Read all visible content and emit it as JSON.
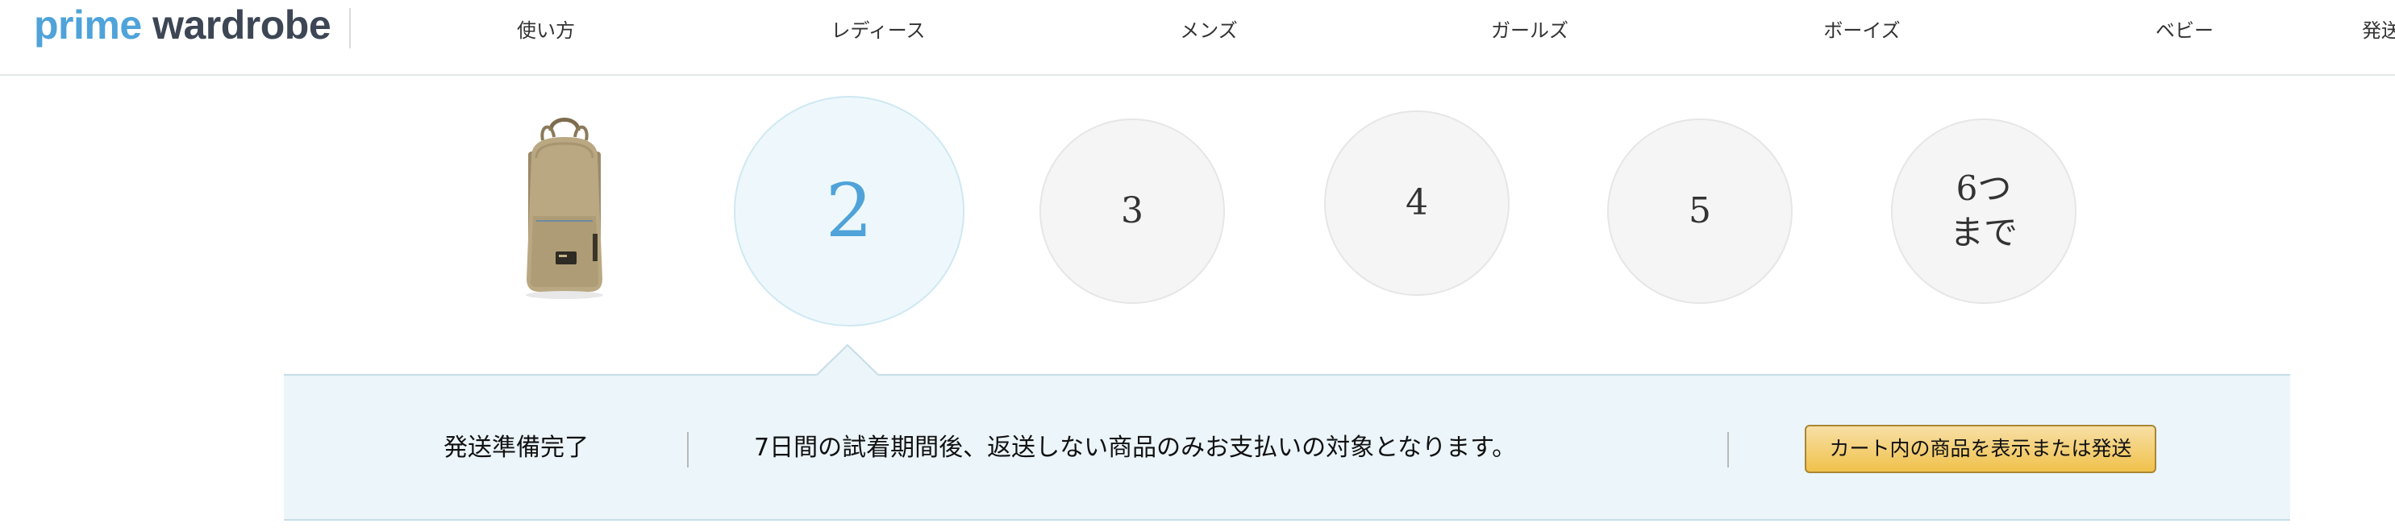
{
  "header": {
    "logo": {
      "prime": "prime",
      "wardrobe": "wardrobe"
    },
    "nav": [
      {
        "label": "使い方"
      },
      {
        "label": "レディース"
      },
      {
        "label": "メンズ"
      },
      {
        "label": "ガールズ"
      },
      {
        "label": "ボーイズ"
      },
      {
        "label": "ベビー"
      },
      {
        "label": "発送"
      }
    ]
  },
  "steps": {
    "product_image": "backpack",
    "items": [
      {
        "label": "2",
        "active": true
      },
      {
        "label": "3",
        "active": false
      },
      {
        "label": "4",
        "active": false
      },
      {
        "label": "5",
        "active": false
      },
      {
        "label": "6つ",
        "label2": "まで",
        "active": false
      }
    ]
  },
  "info_bar": {
    "status": "発送準備完了",
    "message": "7日間の試着期間後、返送しない商品のみお支払いの対象となります。",
    "button_label": "カート内の商品を表示または発送"
  },
  "colors": {
    "brand_prime": "#4fa3d9",
    "brand_wardrobe": "#3d4654",
    "active_step_bg": "#eef8fc",
    "info_bar_bg": "#ecf5fa",
    "button_bg": "#f0c14b"
  }
}
